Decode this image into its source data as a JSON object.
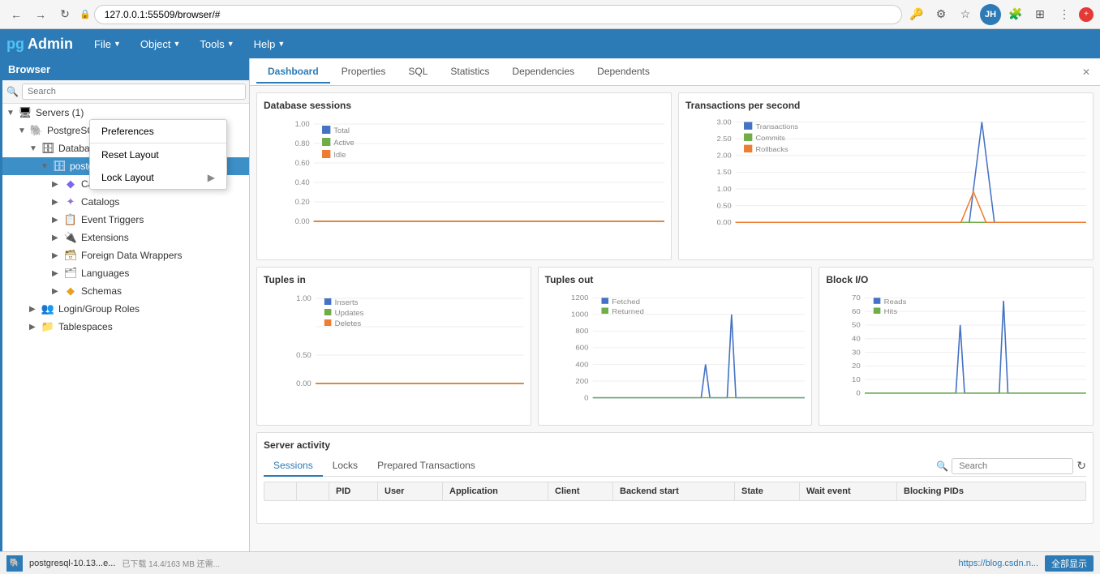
{
  "browser": {
    "url": "127.0.0.1:55509/browser/#",
    "back_label": "←",
    "forward_label": "→",
    "refresh_label": "↻"
  },
  "menubar": {
    "logo": "pgAdmin",
    "logo_pg": "pg",
    "menus": [
      {
        "label": "File",
        "id": "file"
      },
      {
        "label": "Object",
        "id": "object"
      },
      {
        "label": "Tools",
        "id": "tools"
      },
      {
        "label": "Help",
        "id": "help"
      }
    ]
  },
  "sidebar": {
    "header": "Browser",
    "search_placeholder": "Search",
    "tree": [
      {
        "id": "servers",
        "label": "Servers (1)",
        "level": 1,
        "arrow": "▼",
        "icon": "🖥",
        "type": "server-group"
      },
      {
        "id": "postgresql",
        "label": "PostgreSC...",
        "level": 2,
        "arrow": "▼",
        "icon": "🐘",
        "type": "server"
      },
      {
        "id": "databases",
        "label": "Databa...",
        "level": 3,
        "arrow": "▼",
        "icon": "🗄",
        "type": "databases"
      },
      {
        "id": "postgres",
        "label": "postgres",
        "level": 4,
        "arrow": "▼",
        "icon": "🗄",
        "type": "database",
        "selected": true
      },
      {
        "id": "casts",
        "label": "Casts",
        "level": 5,
        "arrow": "▶",
        "icon": "🔷",
        "type": "casts"
      },
      {
        "id": "catalogs",
        "label": "Catalogs",
        "level": 5,
        "arrow": "▶",
        "icon": "💠",
        "type": "catalogs"
      },
      {
        "id": "event-triggers",
        "label": "Event Triggers",
        "level": 5,
        "arrow": "▶",
        "icon": "📋",
        "type": "triggers"
      },
      {
        "id": "extensions",
        "label": "Extensions",
        "level": 5,
        "arrow": "▶",
        "icon": "🔌",
        "type": "extensions"
      },
      {
        "id": "foreign-data-wrappers",
        "label": "Foreign Data Wrappers",
        "level": 5,
        "arrow": "▶",
        "icon": "🗃",
        "type": "fdw"
      },
      {
        "id": "languages",
        "label": "Languages",
        "level": 5,
        "arrow": "▶",
        "icon": "🗂",
        "type": "languages"
      },
      {
        "id": "schemas",
        "label": "Schemas",
        "level": 5,
        "arrow": "▶",
        "icon": "🔶",
        "type": "schemas"
      },
      {
        "id": "login-group-roles",
        "label": "Login/Group Roles",
        "level": 3,
        "arrow": "▶",
        "icon": "👥",
        "type": "roles"
      },
      {
        "id": "tablespaces",
        "label": "Tablespaces",
        "level": 3,
        "arrow": "▶",
        "icon": "📁",
        "type": "tablespaces"
      }
    ]
  },
  "context_menu": {
    "items": [
      {
        "label": "Preferences",
        "id": "preferences",
        "arrow": ""
      },
      {
        "label": "Reset Layout",
        "id": "reset-layout",
        "arrow": ""
      },
      {
        "label": "Lock Layout",
        "id": "lock-layout",
        "arrow": "▶"
      }
    ]
  },
  "tabs": [
    {
      "label": "Dashboard",
      "id": "dashboard",
      "active": true
    },
    {
      "label": "Properties",
      "id": "properties"
    },
    {
      "label": "SQL",
      "id": "sql"
    },
    {
      "label": "Statistics",
      "id": "statistics"
    },
    {
      "label": "Dependencies",
      "id": "dependencies"
    },
    {
      "label": "Dependents",
      "id": "dependents"
    }
  ],
  "dashboard": {
    "db_sessions": {
      "title": "Database sessions",
      "legend": [
        {
          "label": "Total",
          "color": "#4472c4"
        },
        {
          "label": "Active",
          "color": "#70ad47"
        },
        {
          "label": "Idle",
          "color": "#ed7d31"
        }
      ],
      "y_labels": [
        "1.00",
        "0.80",
        "0.60",
        "0.40",
        "0.20",
        "0.00"
      ]
    },
    "transactions_per_second": {
      "title": "Transactions per second",
      "legend": [
        {
          "label": "Transactions",
          "color": "#4472c4"
        },
        {
          "label": "Commits",
          "color": "#70ad47"
        },
        {
          "label": "Rollbacks",
          "color": "#ed7d31"
        }
      ],
      "y_labels": [
        "3.00",
        "2.50",
        "2.00",
        "1.50",
        "1.00",
        "0.50",
        "0.00"
      ],
      "spike_x": 0.78,
      "spike_height": 3.0
    },
    "tuples_in": {
      "title": "Tuples in",
      "legend": [
        {
          "label": "Inserts",
          "color": "#4472c4"
        },
        {
          "label": "Updates",
          "color": "#70ad47"
        },
        {
          "label": "Deletes",
          "color": "#ed7d31"
        }
      ],
      "y_labels": [
        "1.00",
        "",
        "0.50",
        "",
        "0.00"
      ]
    },
    "tuples_out": {
      "title": "Tuples out",
      "legend": [
        {
          "label": "Fetched",
          "color": "#4472c4"
        },
        {
          "label": "Returned",
          "color": "#70ad47"
        }
      ],
      "y_labels": [
        "1200",
        "1000",
        "800",
        "600",
        "400",
        "200",
        "0"
      ]
    },
    "block_io": {
      "title": "Block I/O",
      "legend": [
        {
          "label": "Reads",
          "color": "#4472c4"
        },
        {
          "label": "Hits",
          "color": "#70ad47"
        }
      ],
      "y_labels": [
        "70",
        "60",
        "50",
        "40",
        "30",
        "20",
        "10",
        "0"
      ]
    }
  },
  "server_activity": {
    "title": "Server activity",
    "tabs": [
      "Sessions",
      "Locks",
      "Prepared Transactions"
    ],
    "active_tab": "Sessions",
    "search_placeholder": "Search",
    "columns": [
      "PID",
      "User",
      "Application",
      "Client",
      "Backend start",
      "State",
      "Wait event",
      "Blocking PIDs"
    ]
  },
  "statusbar": {
    "left": "postgresql-10.13...e...",
    "right": "https://blog.csdn.n...",
    "action": "全部显示"
  }
}
